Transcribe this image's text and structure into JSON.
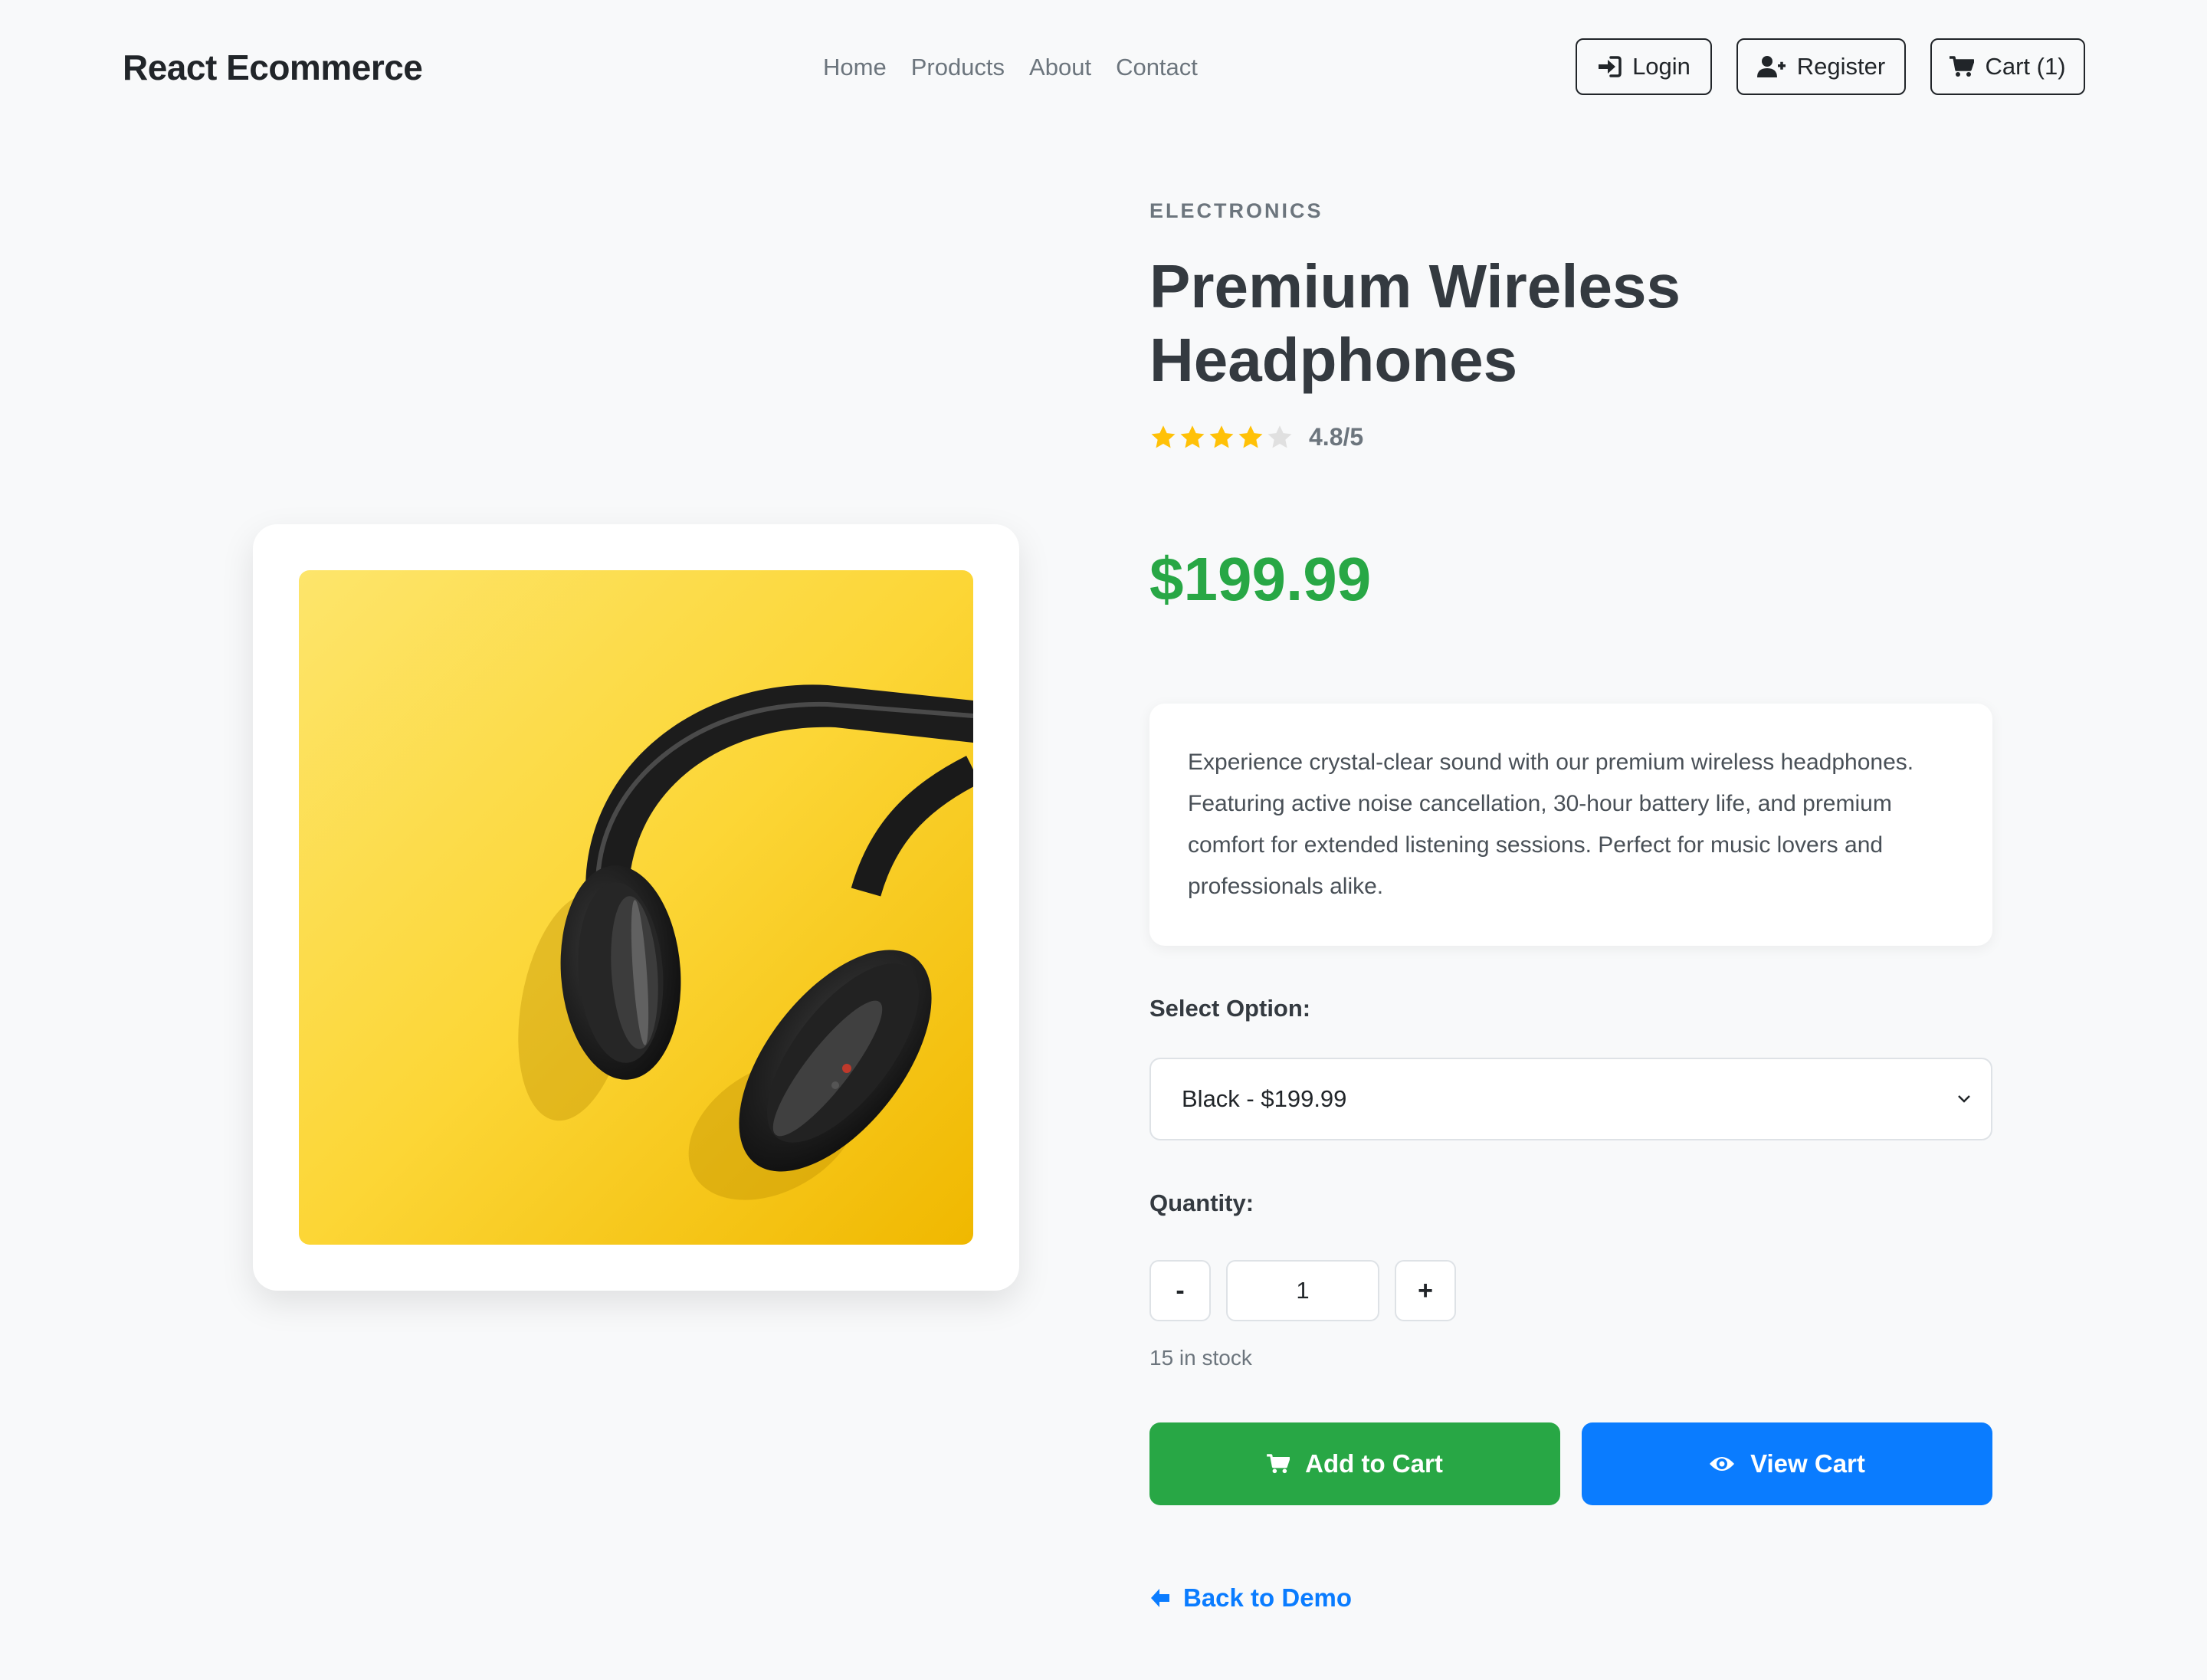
{
  "navbar": {
    "brand": "React Ecommerce",
    "links": [
      "Home",
      "Products",
      "About",
      "Contact"
    ],
    "login_label": "Login",
    "register_label": "Register",
    "cart_label": "Cart (1)",
    "icons": {
      "login": "sign-in-icon",
      "register": "user-plus-icon",
      "cart": "shopping-cart-icon"
    }
  },
  "product": {
    "category": "ELECTRONICS",
    "title": "Premium Wireless Headphones",
    "rating": 4.8,
    "rating_text": "4.8/5",
    "stars_filled": 4,
    "stars_total": 5,
    "price": "$199.99",
    "description": "Experience crystal-clear sound with our premium wireless headphones. Featuring active noise cancellation, 30-hour battery life, and premium comfort for extended listening sessions. Perfect for music lovers and professionals alike.",
    "image_subject": "black headphones on yellow background"
  },
  "options": {
    "label": "Select Option:",
    "selected": "Black - $199.99"
  },
  "quantity": {
    "label": "Quantity:",
    "minus_label": "-",
    "plus_label": "+",
    "value": "1",
    "stock_text": "15 in stock"
  },
  "actions": {
    "add_to_cart_label": "Add to Cart",
    "view_cart_label": "View Cart",
    "back_label": "Back to Demo"
  },
  "colors": {
    "price_green": "#28a745",
    "add_button": "#28a745",
    "view_button": "#0a7cff",
    "star_filled": "#ffc107",
    "star_empty": "#e0e0e0",
    "image_background": "#fcd22c"
  }
}
